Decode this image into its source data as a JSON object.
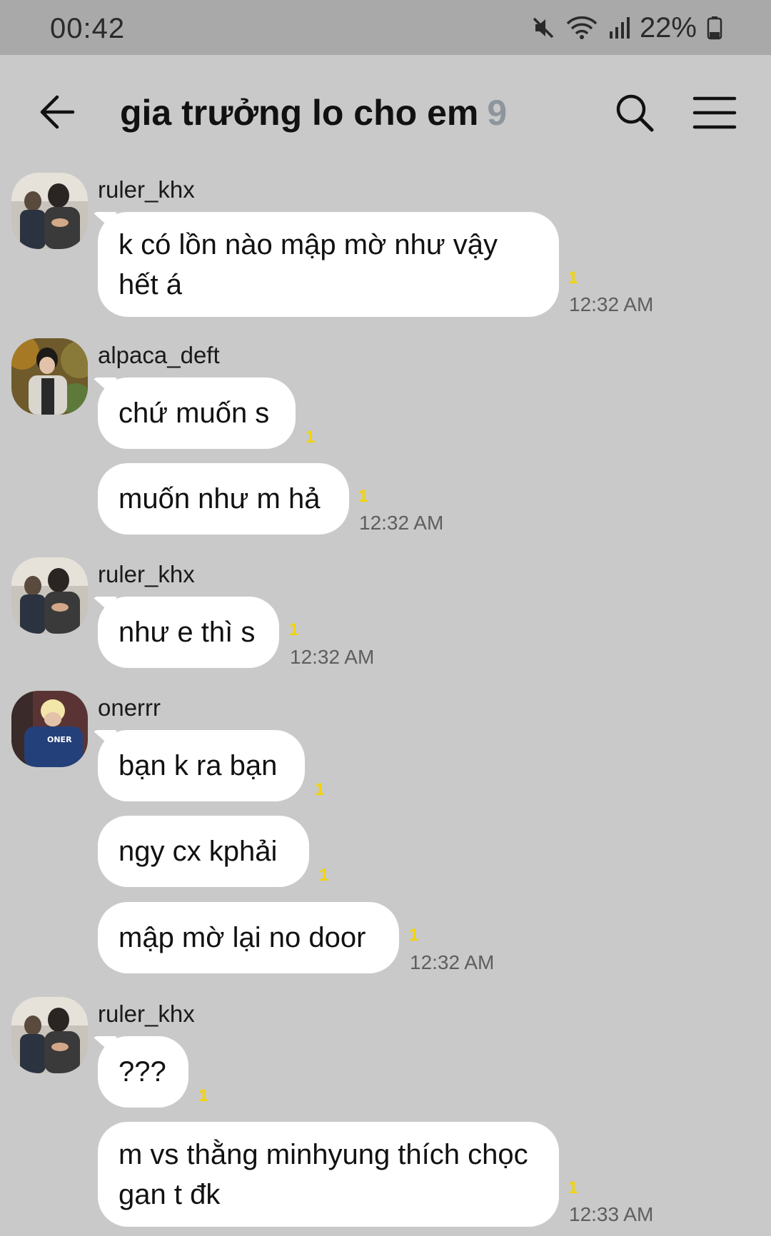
{
  "status": {
    "time": "00:42",
    "battery": "22%"
  },
  "header": {
    "title": "gia trưởng lo cho em",
    "member_count": "9"
  },
  "messages": {
    "g1": {
      "sender": "ruler_khx",
      "b1": "k có lồn nào mập mờ như vậy hết á",
      "unread": "1",
      "time": "12:32 AM"
    },
    "g2": {
      "sender": "alpaca_deft",
      "b1": "chứ muốn s",
      "b1_unread": "1",
      "b2": "muốn như m hả",
      "b2_unread": "1",
      "time": "12:32 AM"
    },
    "g3": {
      "sender": "ruler_khx",
      "b1": "như e thì s",
      "unread": "1",
      "time": "12:32 AM"
    },
    "g4": {
      "sender": "onerrr",
      "b1": "bạn k ra bạn",
      "b1_unread": "1",
      "b2": "ngy cx kphải",
      "b2_unread": "1",
      "b3": "mập mờ lại no door",
      "b3_unread": "1",
      "time": "12:32 AM"
    },
    "g5": {
      "sender": "ruler_khx",
      "b1": "???",
      "b1_unread": "1",
      "b2": "m vs thằng minhyung thích chọc gan t đk",
      "b2_unread": "1",
      "time": "12:33 AM"
    }
  },
  "colors": {
    "background": "#c9c9c9",
    "status_bar": "#a9a9a9",
    "bubble": "#ffffff",
    "unread": "#f3d400",
    "member_count": "#8f959c"
  },
  "icons": [
    "mute-icon",
    "wifi-icon",
    "signal-icon",
    "battery-icon",
    "back-arrow-icon",
    "search-icon",
    "menu-icon"
  ]
}
